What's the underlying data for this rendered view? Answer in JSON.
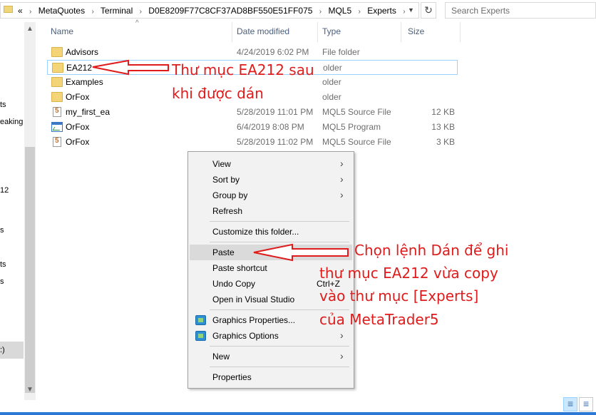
{
  "address": {
    "crumbs": [
      "«",
      "MetaQuotes",
      "Terminal",
      "D0E8209F77C8CF37AD8BF550E51FF075",
      "MQL5",
      "Experts"
    ],
    "search_placeholder": "Search Experts"
  },
  "nav_fragments": [
    "ts",
    "eaking",
    "12",
    "s",
    "ts",
    "s",
    ":)"
  ],
  "columns": {
    "name": "Name",
    "date": "Date modified",
    "type": "Type",
    "size": "Size"
  },
  "files": [
    {
      "name": "Advisors",
      "date": "4/24/2019 6:02 PM",
      "type": "File folder",
      "size": "",
      "icon": "folder-icon"
    },
    {
      "name": "EA212",
      "date": "",
      "type": "older",
      "size": "",
      "icon": "folder-icon"
    },
    {
      "name": "Examples",
      "date": "",
      "type": "older",
      "size": "",
      "icon": "folder-icon"
    },
    {
      "name": "OrFox",
      "date": "",
      "type": "older",
      "size": "",
      "icon": "folder-icon"
    },
    {
      "name": "my_first_ea",
      "date": "5/28/2019 11:01 PM",
      "type": "MQL5 Source File",
      "size": "12 KB",
      "icon": "mql5-source-icon"
    },
    {
      "name": "OrFox",
      "date": "6/4/2019 8:08 PM",
      "type": "MQL5 Program",
      "size": "13 KB",
      "icon": "mql5-program-icon"
    },
    {
      "name": "OrFox",
      "date": "5/28/2019 11:02 PM",
      "type": "MQL5 Source File",
      "size": "3 KB",
      "icon": "mql5-source-icon"
    }
  ],
  "menu": {
    "view": "View",
    "sort_by": "Sort by",
    "group_by": "Group by",
    "refresh": "Refresh",
    "customize": "Customize this folder...",
    "paste": "Paste",
    "paste_shortcut": "Paste shortcut",
    "undo_copy": "Undo Copy",
    "undo_copy_shortcut": "Ctrl+Z",
    "open_vs": "Open in Visual Studio",
    "graphics_properties": "Graphics Properties...",
    "graphics_options": "Graphics Options",
    "new": "New",
    "properties": "Properties"
  },
  "annotations": {
    "folder_note_line1": "Thư mục EA212 sau",
    "folder_note_line2": "khi được dán",
    "paste_note_line1": "Chọn lệnh Dán để ghi",
    "paste_note_line2": "thư mục EA212 vừa copy",
    "paste_note_line3": "vào thư mục [Experts]",
    "paste_note_line4": "của MetaTrader5"
  },
  "colors": {
    "annotation": "#e01b1b",
    "selection_border": "#99d1ff",
    "menu_highlight": "#dadada"
  }
}
